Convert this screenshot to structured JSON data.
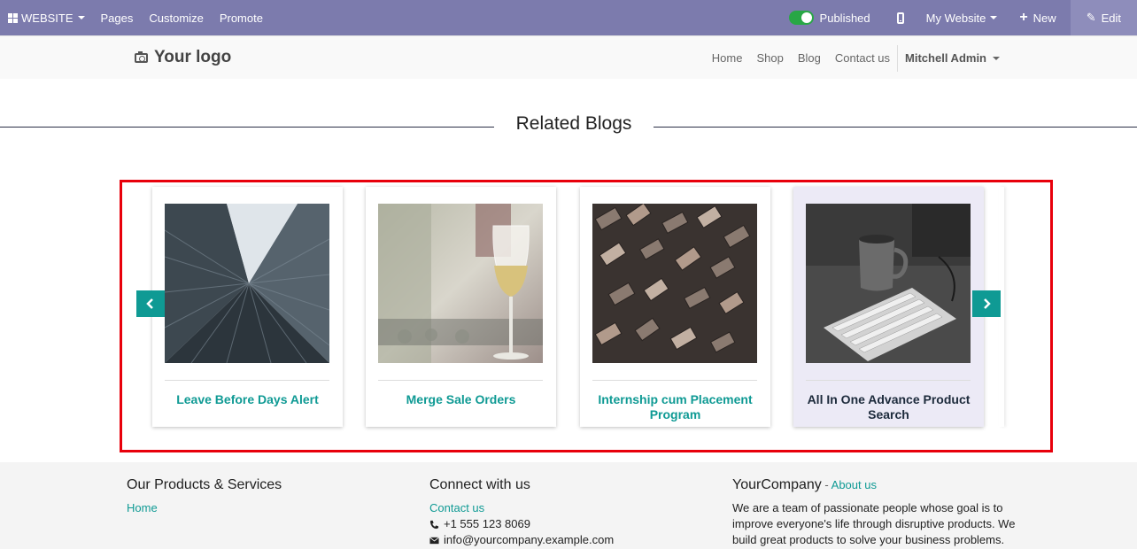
{
  "topbar": {
    "website_label": "WEBSITE",
    "pages_label": "Pages",
    "customize_label": "Customize",
    "promote_label": "Promote",
    "published_label": "Published",
    "my_website_label": "My Website",
    "new_label": "New",
    "edit_label": "Edit",
    "color": "#7c7bad"
  },
  "header": {
    "logo_text": "Your logo",
    "nav": [
      "Home",
      "Shop",
      "Blog",
      "Contact us"
    ],
    "user": "Mitchell Admin"
  },
  "section": {
    "title": "Related Blogs"
  },
  "cards": [
    {
      "title": "Leave Before Days Alert",
      "image": "skyscraper-photo"
    },
    {
      "title": "Merge Sale Orders",
      "image": "wine-glass-photo"
    },
    {
      "title": "Internship cum Placement Program",
      "image": "letterpress-type-photo"
    },
    {
      "title": "All In One Advance Product Search",
      "image": "keyboard-mug-photo"
    }
  ],
  "carousel": {
    "prev_icon": "chevron-left-icon",
    "next_icon": "chevron-right-icon",
    "accent": "#0f9a94"
  },
  "footer": {
    "col1_title": "Our Products & Services",
    "col1_link": "Home",
    "col2_title": "Connect with us",
    "col2_link": "Contact us",
    "phone": "+1 555 123 8069",
    "email": "info@yourcompany.example.com",
    "col3_title": "YourCompany",
    "col3_dash": " - ",
    "col3_link": "About us",
    "col3_text": "We are a team of passionate people whose goal is to improve everyone's life through disruptive products. We build great products to solve your business problems."
  }
}
